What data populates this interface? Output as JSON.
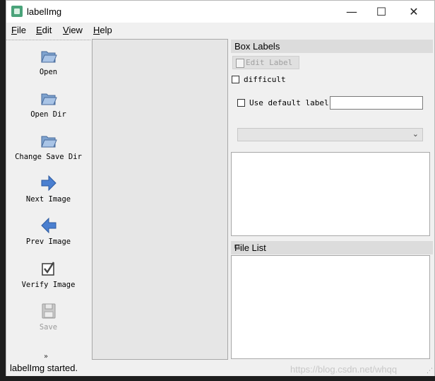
{
  "window": {
    "title": "labelImg",
    "minimize": "—",
    "maximize": "☐",
    "close": "✕"
  },
  "menu": {
    "items": [
      {
        "first": "F",
        "rest": "ile"
      },
      {
        "first": "E",
        "rest": "dit"
      },
      {
        "first": "V",
        "rest": "iew"
      },
      {
        "first": "H",
        "rest": "elp"
      }
    ]
  },
  "toolbar": {
    "items": [
      {
        "label": "Open",
        "icon": "folder-icon"
      },
      {
        "label": "Open Dir",
        "icon": "folder-icon"
      },
      {
        "label": "Change Save Dir",
        "icon": "folder-icon"
      },
      {
        "label": "Next Image",
        "icon": "arrow-right-icon"
      },
      {
        "label": "Prev Image",
        "icon": "arrow-left-icon"
      },
      {
        "label": "Verify Image",
        "icon": "checkbox-icon"
      },
      {
        "label": "Save",
        "icon": "floppy-icon",
        "enabled": false
      }
    ],
    "more": "»"
  },
  "box_labels": {
    "title": "Box Labels",
    "edit_label": "Edit Label",
    "difficult": "difficult",
    "use_default_label": "Use default label",
    "default_label_value": "",
    "combo_arrow": "⌄"
  },
  "file_list": {
    "title": "File List",
    "float_icon": "⧉"
  },
  "status": {
    "text": "labelImg started.",
    "watermark": "https://blog.csdn.net/whqq",
    "grip": "⋰"
  },
  "colors": {
    "folder": "#5b86b8",
    "arrow": "#3f74c4",
    "accent": "#4aa37a"
  }
}
